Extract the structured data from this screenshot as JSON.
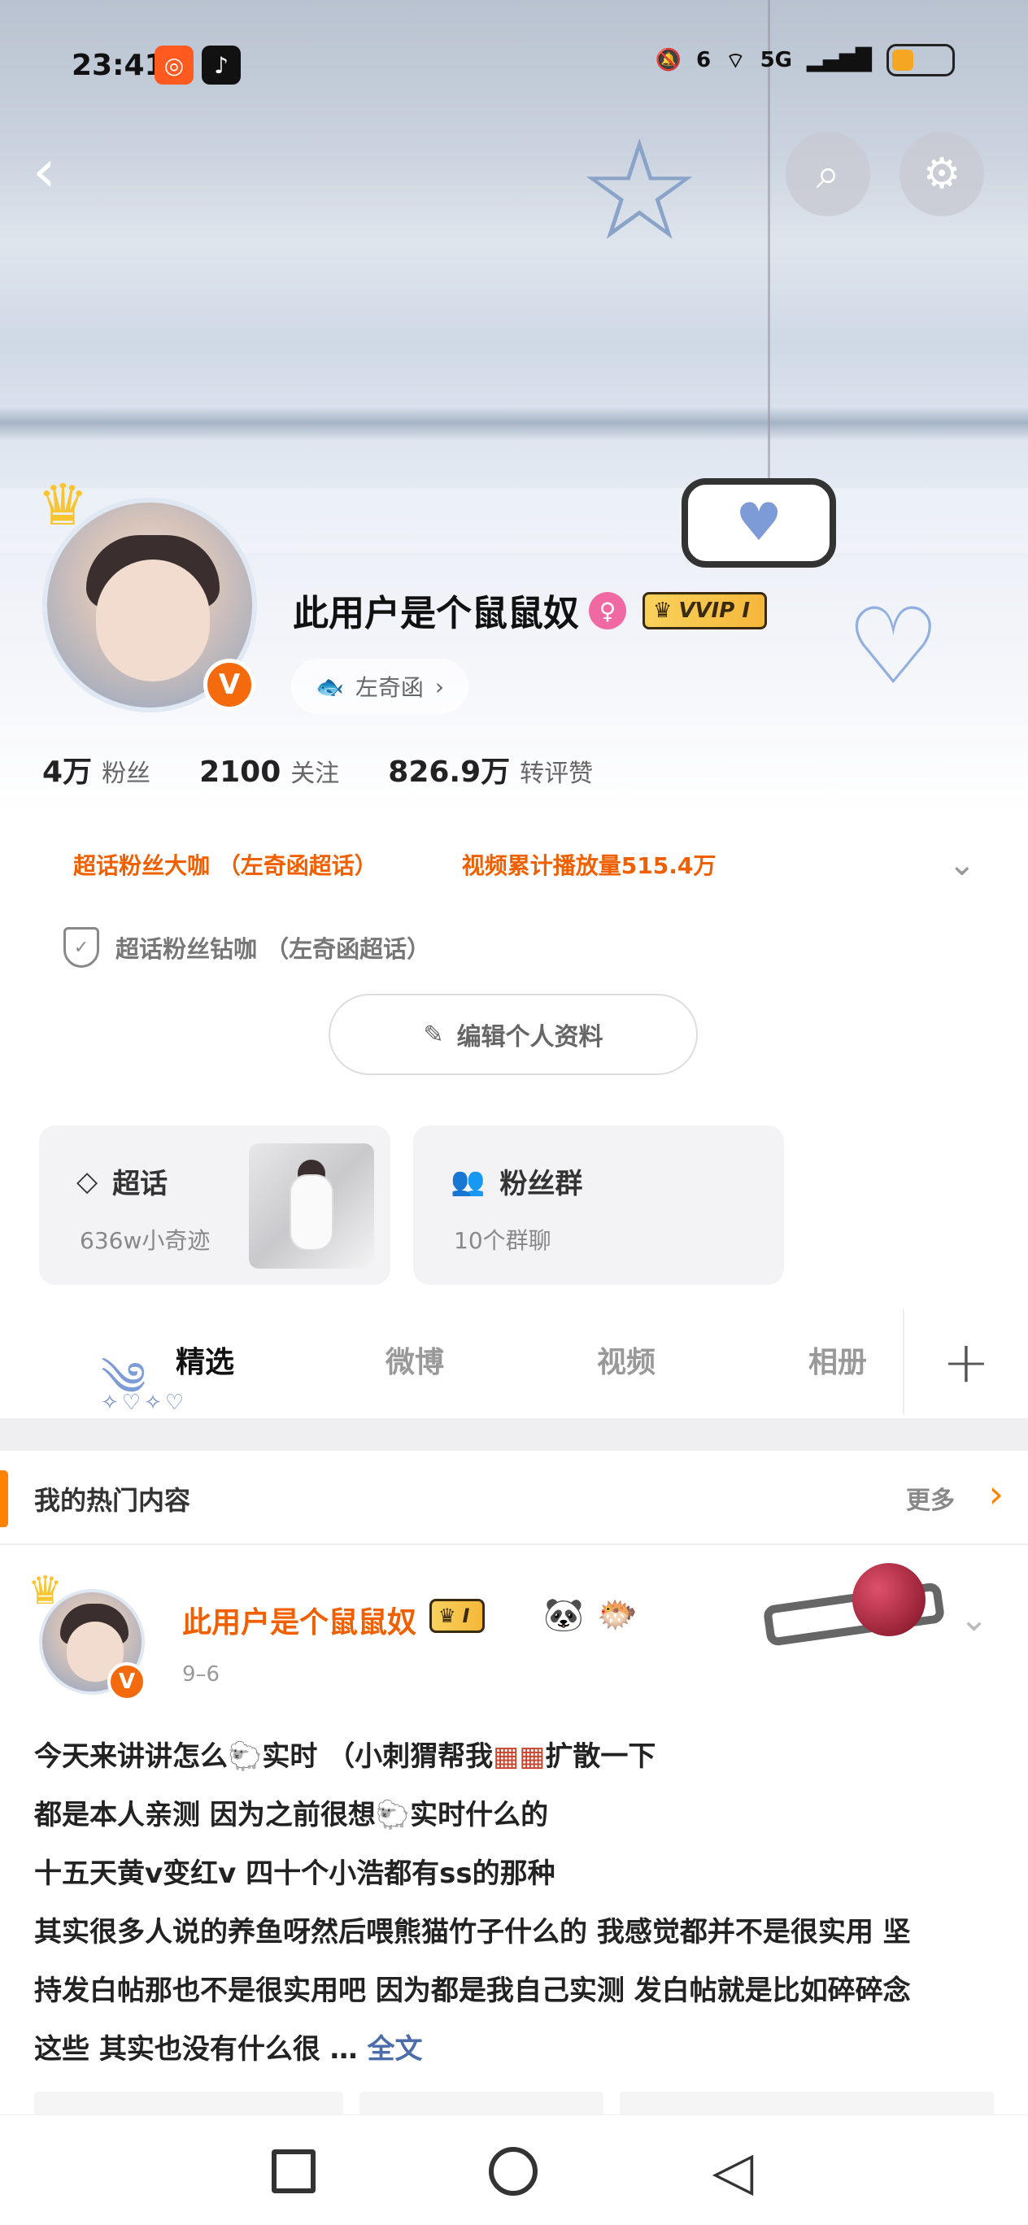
{
  "status_bar": {
    "time": "23:41",
    "app_icons": [
      "kuaishou-icon",
      "tiktok-icon"
    ],
    "network": "5G",
    "signal_extra": "6"
  },
  "profile": {
    "username": "此用户是个鼠鼠奴",
    "vip_label": "VVIP I",
    "fish_tag_label": "左奇函",
    "stats": [
      {
        "num": "4万",
        "label": "粉丝"
      },
      {
        "num": "2100",
        "label": "关注"
      },
      {
        "num": "826.9万",
        "label": "转评赞"
      }
    ],
    "tags": [
      "超话粉丝大咖 （左奇函超话）",
      "视频累计播放量515.4万"
    ],
    "badge_text": "超话粉丝钻咖 （左奇函超话）",
    "edit_label": "编辑个人资料"
  },
  "cards": {
    "chaohua": {
      "title": "超话",
      "sub": "636w小奇迹"
    },
    "fans": {
      "title": "粉丝群",
      "sub": "10个群聊"
    }
  },
  "tabs": [
    "精选",
    "微博",
    "视频",
    "相册"
  ],
  "tab_dots": "✧♡✧♡",
  "hot": {
    "title": "我的热门内容",
    "more": "更多"
  },
  "post": {
    "author": "此用户是个鼠鼠奴",
    "vip_label": "I",
    "date": "9–6",
    "lines": [
      "今天来讲讲怎么🐑实时 （小刺猬帮我",
      "扩散一下",
      "都是本人亲测 因为之前很想🐑实时什么的",
      "十五天黄v变红v 四十个小浩都有ss的那种",
      "其实很多人说的养鱼呀然后喂熊猫竹子什么的 我感觉都并不是很实用 坚",
      "持发白帖那也不是很实用吧 因为都是我自己实测 发白帖就是比如碎碎念",
      "这些 其实也没有什么很 …"
    ],
    "full_text_label": "全文"
  },
  "colors": {
    "accent_orange": "#f06000",
    "link_blue": "#4b6eab",
    "vip_gold": "#f6b73a"
  }
}
